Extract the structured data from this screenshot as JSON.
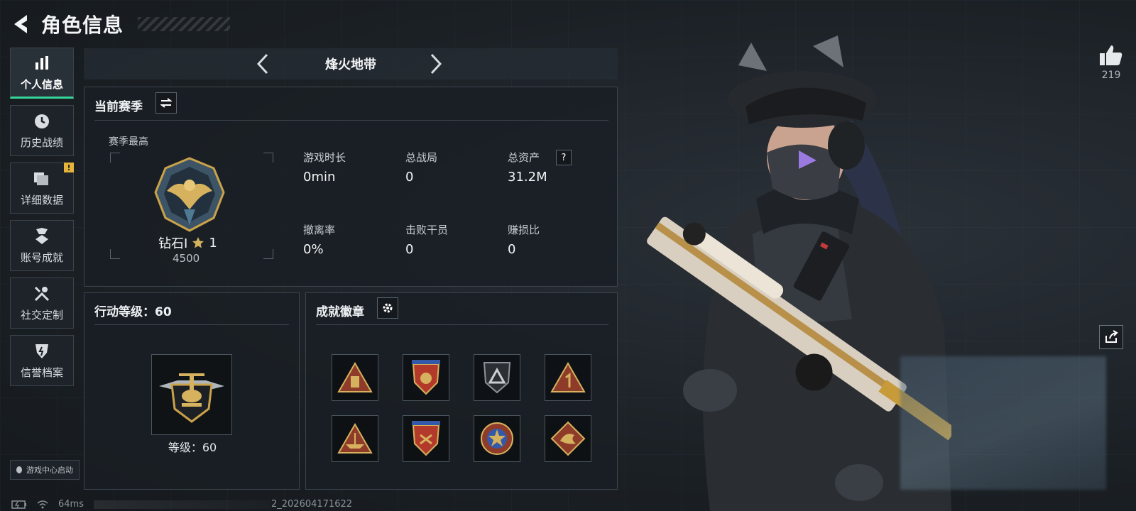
{
  "header": {
    "title": "角色信息"
  },
  "sidebar": {
    "items": [
      {
        "label": "个人信息",
        "icon": "bar-chart-icon",
        "active": true
      },
      {
        "label": "历史战绩",
        "icon": "history-clock-icon"
      },
      {
        "label": "详细数据",
        "icon": "folder-icon",
        "badge": "!"
      },
      {
        "label": "账号成就",
        "icon": "achievement-icon"
      },
      {
        "label": "社交定制",
        "icon": "tools-icon"
      },
      {
        "label": "信誉档案",
        "icon": "shield-icon"
      }
    ],
    "launch_label": "游戏中心启动"
  },
  "mode_selector": {
    "title": "烽火地带"
  },
  "season_panel": {
    "title": "当前赛季",
    "best_label": "赛季最高",
    "rank_name": "钻石Ⅰ",
    "rank_stars": "1",
    "rank_points": "4500",
    "stats": [
      {
        "label": "游戏时长",
        "value": "0min"
      },
      {
        "label": "总战局",
        "value": "0"
      },
      {
        "label": "总资产",
        "value": "31.2M",
        "help": "?"
      },
      {
        "label": "撤离率",
        "value": "0%"
      },
      {
        "label": "击败干员",
        "value": "0"
      },
      {
        "label": "赚损比",
        "value": "0"
      }
    ]
  },
  "level_panel": {
    "title": "行动等级：60",
    "level_label": "等级：60"
  },
  "achievement_panel": {
    "title": "成就徽章",
    "badges": [
      "triangle-cup-badge",
      "red-shield-stars-badge",
      "dark-shield-triangle-badge",
      "red-triangle-one-badge",
      "triangle-boat-badge",
      "shield-stars-badge",
      "star-emblem-badge",
      "dragon-diamond-badge"
    ]
  },
  "right_panel": {
    "likes": "219"
  },
  "status_bar": {
    "ping": "64ms",
    "build": "2_202604171622"
  },
  "colors": {
    "accent": "#35d49a",
    "badge_warning": "#e6b33a",
    "gold": "#c9a24a",
    "background": "#1b2025"
  }
}
